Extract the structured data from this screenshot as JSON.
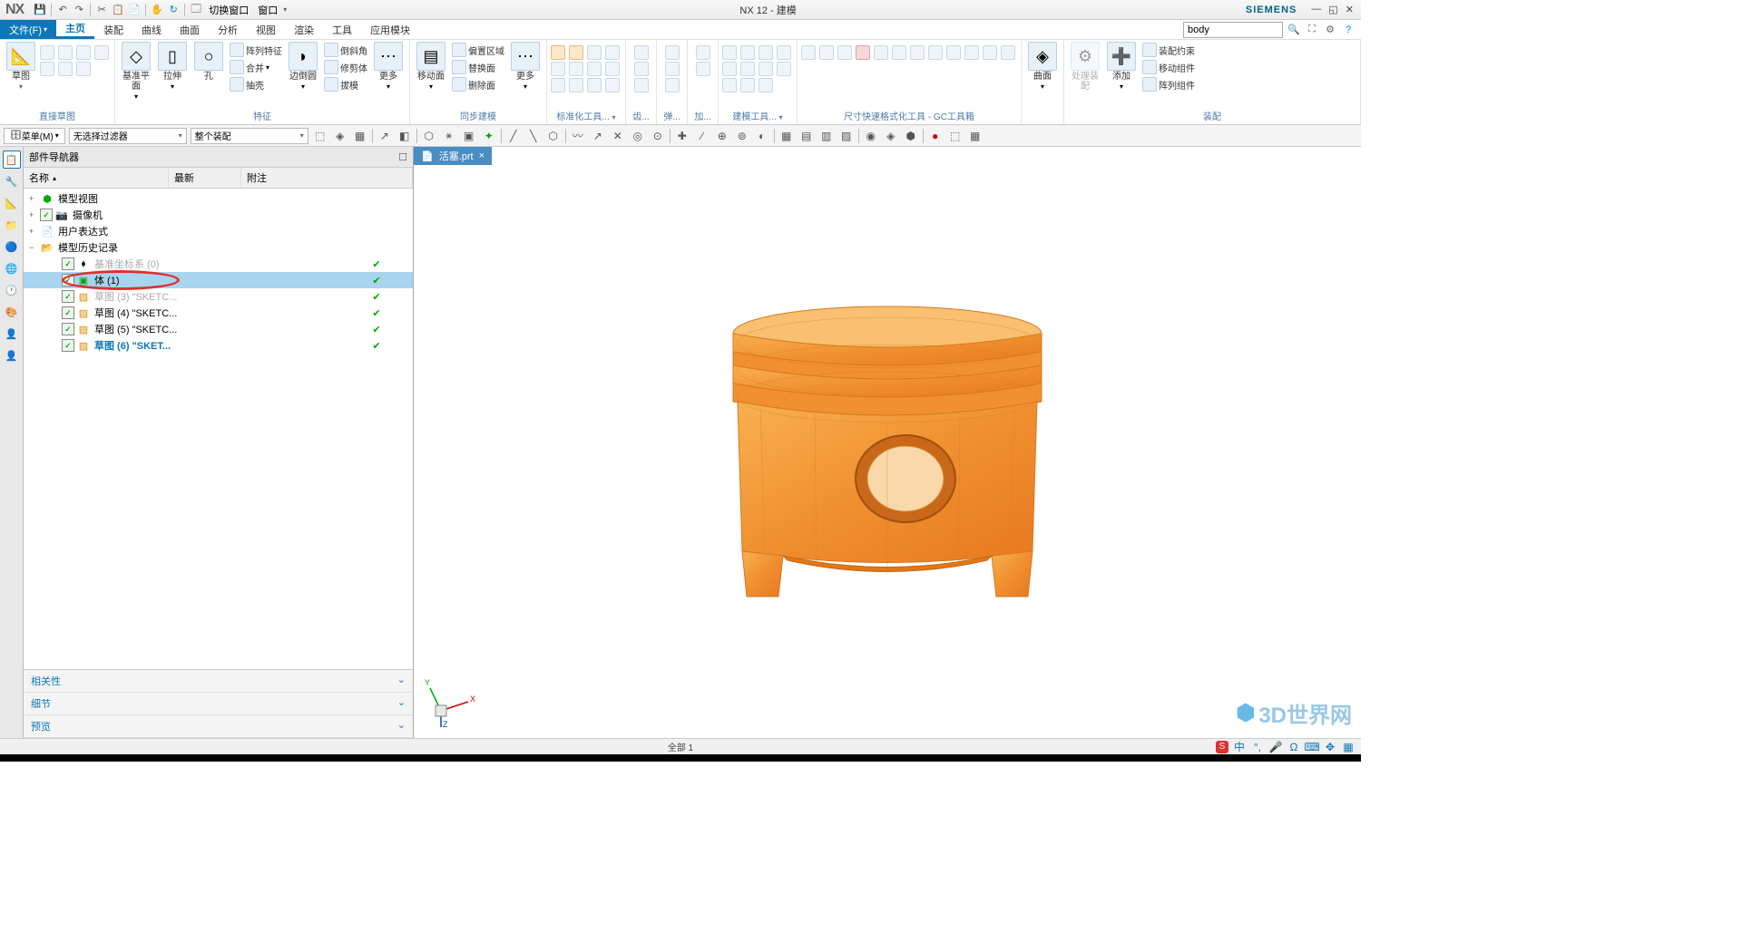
{
  "titlebar": {
    "logo": "NX",
    "qat": {
      "switch_window": "切换窗口",
      "window": "窗口"
    },
    "title": "NX 12 - 建模",
    "brand": "SIEMENS"
  },
  "menubar": {
    "file": "文件(F)",
    "tabs": [
      "主页",
      "装配",
      "曲线",
      "曲面",
      "分析",
      "视图",
      "渲染",
      "工具",
      "应用模块"
    ],
    "search_value": "body"
  },
  "ribbon": {
    "groups": {
      "sketch": {
        "label": "直接草图",
        "big1": "草图"
      },
      "feature": {
        "label": "特征",
        "datum": "基准平面",
        "extrude": "拉伸",
        "hole": "孔",
        "pattern": "阵列特征",
        "unite": "合并",
        "shell": "抽壳",
        "edge_blend": "边倒圆",
        "chamfer": "倒斜角",
        "trim": "修剪体",
        "draft": "拔模",
        "more": "更多"
      },
      "sync": {
        "label": "同步建模",
        "move_face": "移动面",
        "offset_region": "偏置区域",
        "replace_face": "替换面",
        "delete_face": "删除面",
        "more": "更多"
      },
      "std": {
        "label": "标准化工具...",
        "gear": "齿..."
      },
      "spring": {
        "label": "弹..."
      },
      "ext": {
        "label": "加..."
      },
      "model_tools": {
        "label": "建模工具..."
      },
      "gc": {
        "label": "尺寸快速格式化工具 - GC工具箱"
      },
      "surface": {
        "label": "",
        "surf": "曲面"
      },
      "assy": {
        "label": "装配",
        "process": "处理装配",
        "add": "添加",
        "assy_constraint": "装配约束",
        "move_comp": "移动组件",
        "pattern_comp": "阵列组件"
      }
    }
  },
  "filterbar": {
    "menu": "菜单(M)",
    "filter1": "无选择过滤器",
    "filter2": "整个装配"
  },
  "navigator": {
    "title": "部件导航器",
    "cols": {
      "name": "名称",
      "latest": "最新",
      "note": "附注"
    },
    "tree": [
      {
        "name": "模型视图",
        "expand": "+",
        "icon": "🟢"
      },
      {
        "name": "摄像机",
        "expand": "+",
        "check": true,
        "icon": "📷"
      },
      {
        "name": "用户表达式",
        "expand": "+",
        "icon": "📄"
      },
      {
        "name": "模型历史记录",
        "expand": "−",
        "icon": "📁"
      },
      {
        "name": "基准坐标系 (0)",
        "indent": 2,
        "check": true,
        "greyed": true,
        "latest": "✔"
      },
      {
        "name": "体 (1)",
        "indent": 2,
        "check": true,
        "selected": true,
        "latest": "✔",
        "circled": true
      },
      {
        "name": "草图 (3) \"SKETC...",
        "indent": 2,
        "check": true,
        "greyed": true,
        "latest": "✔"
      },
      {
        "name": "草图 (4) \"SKETC...",
        "indent": 2,
        "check": true,
        "latest": "✔"
      },
      {
        "name": "草图 (5) \"SKETC...",
        "indent": 2,
        "check": true,
        "latest": "✔"
      },
      {
        "name": "草图 (6) \"SKET...",
        "indent": 2,
        "check": true,
        "blue": true,
        "latest": "✔"
      }
    ],
    "footer": {
      "related": "相关性",
      "detail": "细节",
      "preview": "预览"
    }
  },
  "viewport": {
    "tab": "活塞.prt",
    "triad": {
      "x": "X",
      "y": "Y",
      "z": "Z"
    }
  },
  "watermark": "3D世界网",
  "statusbar": {
    "text": "全部 1",
    "ime": "中"
  }
}
